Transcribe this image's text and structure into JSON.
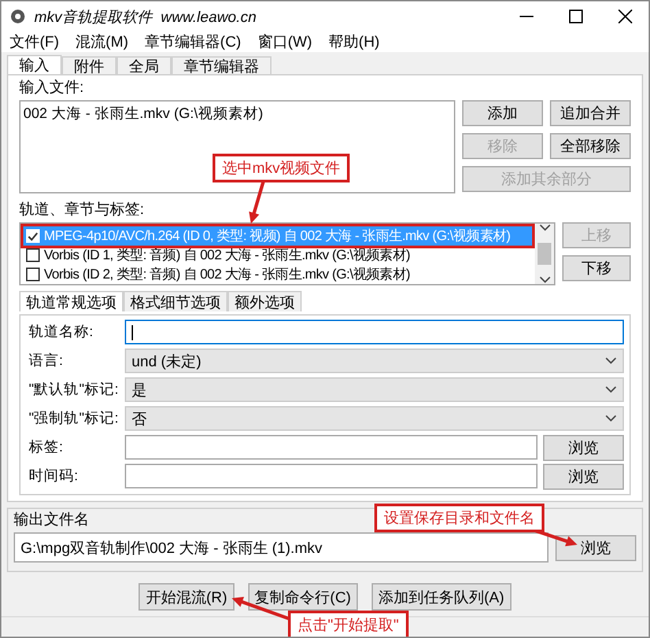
{
  "window": {
    "title": "mkv音轨提取软件  www.leawo.cn"
  },
  "menu": [
    "文件(F)",
    "混流(M)",
    "章节编辑器(C)",
    "窗口(W)",
    "帮助(H)"
  ],
  "tabs": [
    {
      "label": "输入",
      "selected": true
    },
    {
      "label": "附件",
      "selected": false
    },
    {
      "label": "全局",
      "selected": false
    },
    {
      "label": "章节编辑器",
      "selected": false
    }
  ],
  "input_files": {
    "label": "输入文件:",
    "items": [
      "002 大海 - 张雨生.mkv (G:\\视频素材)"
    ],
    "buttons": [
      {
        "label": "添加",
        "disabled": false
      },
      {
        "label": "追加合并",
        "disabled": false
      },
      {
        "label": "移除",
        "disabled": true
      },
      {
        "label": "全部移除",
        "disabled": false
      },
      {
        "label": "添加其余部分",
        "disabled": true
      }
    ]
  },
  "tracks": {
    "label": "轨道、章节与标签:",
    "items": [
      {
        "text": "MPEG-4p10/AVC/h.264 (ID 0, 类型: 视频) 自 002 大海 - 张雨生.mkv (G:\\视频素材)",
        "checked": true,
        "selected": true
      },
      {
        "text": "Vorbis (ID 1, 类型: 音频) 自 002 大海 - 张雨生.mkv (G:\\视频素材)",
        "checked": false,
        "selected": false
      },
      {
        "text": "Vorbis (ID 2, 类型: 音频) 自 002 大海 - 张雨生.mkv (G:\\视频素材)",
        "checked": false,
        "selected": false
      }
    ],
    "buttons": [
      {
        "label": "上移",
        "disabled": true
      },
      {
        "label": "下移",
        "disabled": false
      }
    ]
  },
  "sub_tabs": [
    {
      "label": "轨道常规选项",
      "selected": true
    },
    {
      "label": "格式细节选项",
      "selected": false
    },
    {
      "label": "额外选项",
      "selected": false
    }
  ],
  "fields": [
    {
      "kind": "text",
      "label": "轨道名称:",
      "focused": true
    },
    {
      "kind": "select",
      "label": "语言:",
      "value": "und (未定)"
    },
    {
      "kind": "select",
      "label": "\"默认轨\"标记:",
      "value": "是"
    },
    {
      "kind": "select",
      "label": "\"强制轨\"标记:",
      "value": "否"
    },
    {
      "kind": "browse",
      "label": "标签:",
      "button": "浏览"
    },
    {
      "kind": "browse",
      "label": "时间码:",
      "button": "浏览"
    }
  ],
  "output": {
    "label": "输出文件名",
    "value": "G:\\mpg双音轨制作\\002 大海 - 张雨生 (1).mkv",
    "button": "浏览"
  },
  "actions": [
    "开始混流(R)",
    "复制命令行(C)",
    "添加到任务队列(A)"
  ],
  "annotations": [
    "选中mkv视频文件",
    "设置保存目录和文件名",
    "点击\"开始提取\""
  ]
}
